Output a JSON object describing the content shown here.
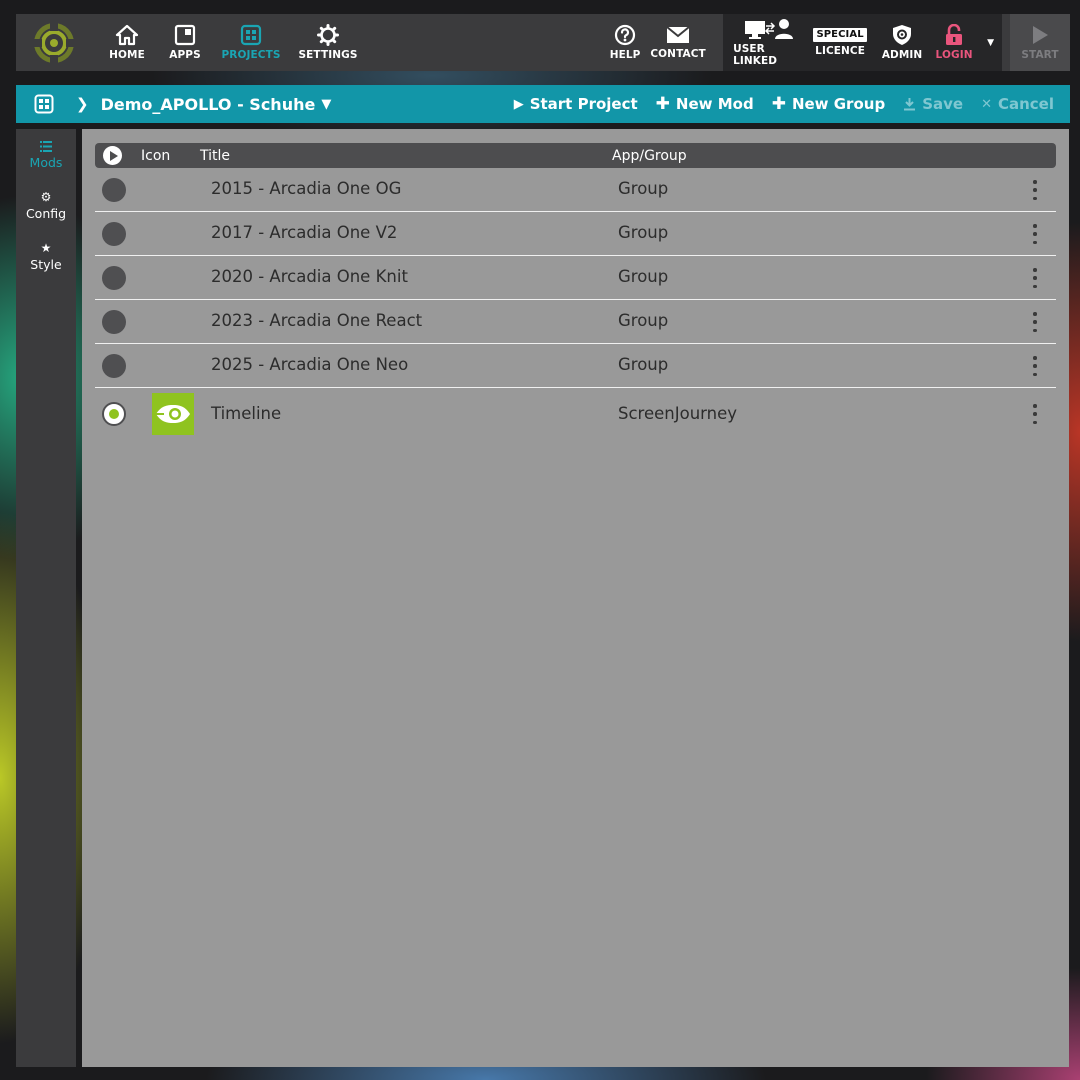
{
  "nav": {
    "items": [
      {
        "id": "home",
        "label": "HOME",
        "icon": "home-icon"
      },
      {
        "id": "apps",
        "label": "APPS",
        "icon": "apps-icon"
      },
      {
        "id": "projects",
        "label": "PROJECTS",
        "icon": "projects-grid-icon",
        "active": true
      },
      {
        "id": "settings",
        "label": "SETTINGS",
        "icon": "gear-icon"
      }
    ],
    "help": {
      "label": "HELP",
      "icon": "question-circle-icon"
    },
    "contact": {
      "label": "CONTACT",
      "icon": "envelope-icon"
    },
    "user_linked": {
      "label": "USER LINKED",
      "icon": "monitor-user-link-icon"
    },
    "licence": {
      "label": "LICENCE",
      "badge": "SPECIAL"
    },
    "admin": {
      "label": "ADMIN",
      "icon": "shield-gear-icon"
    },
    "login": {
      "label": "LOGIN",
      "icon": "unlocked-padlock-icon",
      "color": "#e9557d"
    },
    "start": {
      "label": "START",
      "icon": "play-triangle-icon"
    }
  },
  "project": {
    "title": "Demo_APOLLO - Schuhe",
    "actions": {
      "start_project": "Start Project",
      "new_mod": "New Mod",
      "new_group": "New Group",
      "save": "Save",
      "cancel": "Cancel"
    }
  },
  "side_tabs": [
    {
      "id": "mods",
      "label": "Mods",
      "icon": "list-icon",
      "active": true
    },
    {
      "id": "config",
      "label": "Config",
      "icon": "gear-icon"
    },
    {
      "id": "style",
      "label": "Style",
      "icon": "star-icon"
    }
  ],
  "table": {
    "columns": {
      "icon": "Icon",
      "title": "Title",
      "app_group": "App/Group"
    },
    "rows": [
      {
        "title": "2015 - Arcadia One OG",
        "app_group": "Group",
        "selected": false
      },
      {
        "title": "2017 - Arcadia One V2",
        "app_group": "Group",
        "selected": false
      },
      {
        "title": "2020 - Arcadia One Knit",
        "app_group": "Group",
        "selected": false
      },
      {
        "title": "2023 - Arcadia One React",
        "app_group": "Group",
        "selected": false
      },
      {
        "title": "2025 - Arcadia One Neo",
        "app_group": "Group",
        "selected": false
      },
      {
        "title": "Timeline",
        "app_group": "ScreenJourney",
        "selected": true,
        "icon": "eye-icon"
      }
    ]
  },
  "colors": {
    "accent": "#1296a8",
    "active_nav": "#1aa5b3",
    "login": "#e9557d",
    "app_icon_bg": "#8fc31f",
    "panel_bg": "#999999",
    "topbar_bg": "#3b3b3d"
  }
}
